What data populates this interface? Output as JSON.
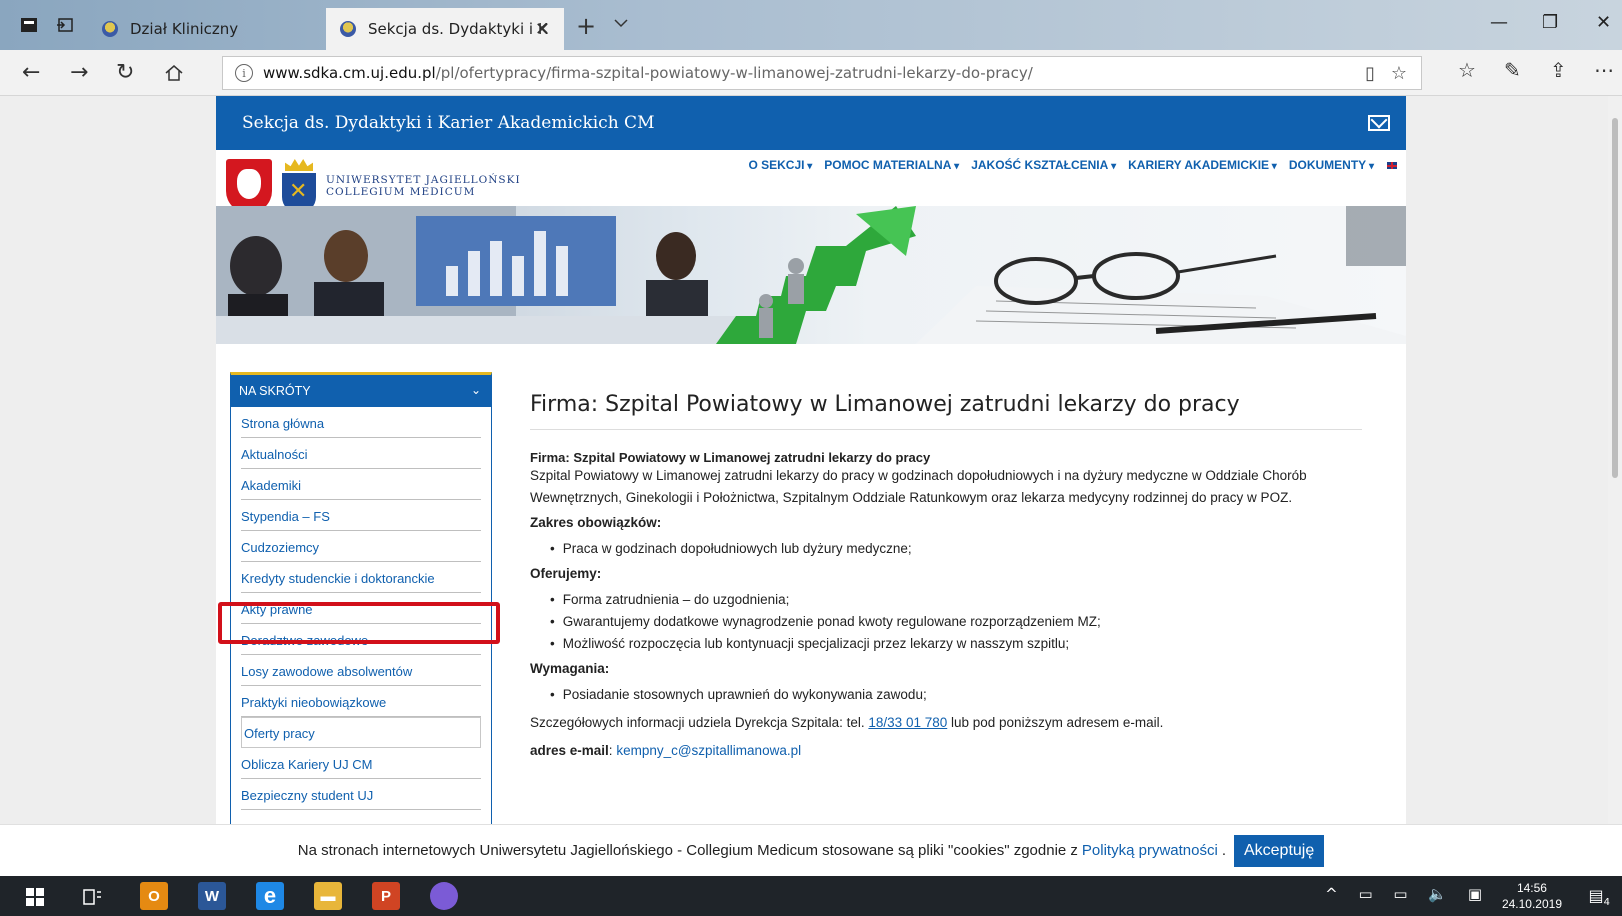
{
  "browser": {
    "tabs": [
      {
        "label": "Dział Kliniczny"
      },
      {
        "label": "Sekcja ds. Dydaktyki i K"
      }
    ],
    "url_host": "www.sdka.cm.uj.edu.pl",
    "url_path": "/pl/ofertypracy/firma-szpital-powiatowy-w-limanowej-zatrudni-lekarzy-do-pracy/"
  },
  "site": {
    "header_title": "Sekcja ds. Dydaktyki i Karier Akademickich CM",
    "brand_line1": "UNIWERSYTET JAGIELLOŃSKI",
    "brand_line2": "COLLEGIUM MEDICUM",
    "nav": [
      "O SEKCJI",
      "POMOC MATERIALNA",
      "JAKOŚĆ KSZTAŁCENIA",
      "KARIERY AKADEMICKIE",
      "DOKUMENTY"
    ]
  },
  "sidebar": {
    "heading": "NA SKRÓTY",
    "items": [
      "Strona główna",
      "Aktualności",
      "Akademiki",
      "Stypendia – FS",
      "Cudzoziemcy",
      "Kredyty studenckie i doktoranckie",
      "Akty prawne",
      "Doradztwo zawodowe",
      "Losy zawodowe absolwentów",
      "Praktyki nieobowiązkowe",
      "Oferty pracy",
      "Oblicza Kariery UJ CM",
      "Bezpieczny student UJ"
    ]
  },
  "article": {
    "title": "Firma: Szpital Powiatowy w Limanowej zatrudni lekarzy do pracy",
    "subtitle": "Firma: Szpital Powiatowy w Limanowej zatrudni lekarzy do pracy",
    "intro": "Szpital Powiatowy w Limanowej zatrudni lekarzy do pracy w godzinach dopołudniowych i na dyżury medyczne w Oddziale Chorób Wewnętrznych, Ginekologii i Położnictwa, Szpitalnym Oddziale Ratunkowym oraz lekarza medycyny rodzinnej do pracy w POZ.",
    "duties_heading": "Zakres obowiązków:",
    "duties": [
      "Praca w godzinach dopołudniowych lub dyżury medyczne;"
    ],
    "offer_heading": "Oferujemy:",
    "offer": [
      "Forma zatrudnienia – do uzgodnienia;",
      "Gwarantujemy dodatkowe wynagrodzenie ponad kwoty regulowane rozporządzeniem MZ;",
      "Możliwość rozpoczęcia lub kontynuacji specjalizacji przez lekarzy w nasszym szpitlu;"
    ],
    "req_heading": "Wymagania:",
    "requirements": [
      "Posiadanie stosownych uprawnień do wykonywania zawodu;"
    ],
    "contact_prefix": "Szczegółowych informacji udziela Dyrekcja Szpitala: tel.",
    "contact_phone": "18/33 01 780",
    "contact_suffix": "lub pod poniższym adresem e-mail.",
    "email_label": "adres e-mail",
    "email": "kempny_c@szpitallimanowa.pl"
  },
  "cookie": {
    "text": "Na stronach internetowych Uniwersytetu Jagiellońskiego - Collegium Medicum stosowane są pliki \"cookies\" zgodnie z",
    "policy_link": "Polityką prywatności",
    "accept": "Akceptuję"
  },
  "taskbar": {
    "time": "14:56",
    "date": "24.10.2019",
    "notif_count": "4"
  },
  "colors": {
    "site_blue": "#1060ae",
    "highlight_red": "#d2101a"
  }
}
